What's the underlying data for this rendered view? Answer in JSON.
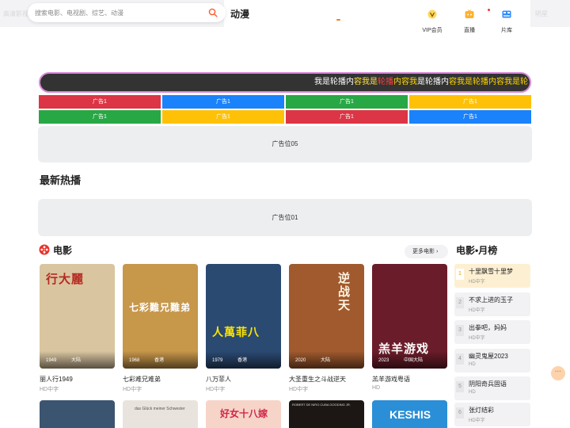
{
  "header": {
    "search_placeholder": "搜索电影、电视剧、综艺、动漫",
    "brand": "动漫",
    "faint_left": "高清影视",
    "faint_right": "明星",
    "nav": [
      {
        "label": "VIP会员",
        "icon": "vip-icon"
      },
      {
        "label": "直播",
        "icon": "live-tv-icon"
      },
      {
        "label": "片库",
        "icon": "film-library-icon"
      }
    ]
  },
  "marquee": {
    "segments": [
      {
        "text": "我是轮播内",
        "color": "#ffffff"
      },
      {
        "text": "容我是",
        "color": "#ffe040"
      },
      {
        "text": "轮播",
        "color": "#ff4040"
      },
      {
        "text": "内容我",
        "color": "#ffd700"
      },
      {
        "text": "是轮播内",
        "color": "#ffffff"
      },
      {
        "text": "容我是轮播内容我是轮",
        "color": "#ffd700"
      }
    ]
  },
  "ad_grid": [
    {
      "label": "广告1",
      "color": "#dc3545"
    },
    {
      "label": "广告1",
      "color": "#1a82fb"
    },
    {
      "label": "广告1",
      "color": "#28a745"
    },
    {
      "label": "广告1",
      "color": "#ffc107"
    },
    {
      "label": "广告1",
      "color": "#28a745"
    },
    {
      "label": "广告1",
      "color": "#ffc107"
    },
    {
      "label": "广告1",
      "color": "#dc3545"
    },
    {
      "label": "广告1",
      "color": "#1a82fb"
    }
  ],
  "ad_slot_05": "广告位05",
  "latest_title": "最新热播",
  "ad_slot_01": "广告位01",
  "movies": {
    "title": "电影",
    "more": "更多电影 ›",
    "items": [
      {
        "title": "丽人行1949",
        "quality": "HD中字",
        "year": "1949",
        "region": "大陆",
        "poster_text": "行大麗",
        "bg": "#d9c5a0",
        "fg": "#b52a22"
      },
      {
        "title": "七彩难兄难弟",
        "quality": "HD中字",
        "year": "1968",
        "region": "香港",
        "poster_text": "七彩難兄難弟",
        "bg": "#c7974a",
        "fg": "#ffffff"
      },
      {
        "title": "八万菲人",
        "quality": "HD中字",
        "year": "1979",
        "region": "香港",
        "poster_text": "人萬菲八",
        "bg": "#2b4a72",
        "fg": "#ffe600"
      },
      {
        "title": "大圣重生之斗战逆天",
        "quality": "HD中字",
        "year": "2020",
        "region": "大陆",
        "poster_text": "逆战天",
        "bg": "#a15a2e",
        "fg": "#fff3e0"
      },
      {
        "title": "羔羊游戏粤语",
        "quality": "HD",
        "year": "2023",
        "region": "中国大陆",
        "poster_text": "羔羊游戏",
        "bg": "#6b1c2a",
        "fg": "#ffffff"
      }
    ],
    "row2": [
      {
        "poster_text": "",
        "bg": "#3b5470",
        "fg": "#ffffff"
      },
      {
        "poster_text": "das Glück meiner Schwester",
        "bg": "#e8e4dd",
        "fg": "#555555"
      },
      {
        "poster_text": "好女十八嫁",
        "bg": "#f6d4c8",
        "fg": "#d0284a"
      },
      {
        "poster_text": "ROBERT DE NIRO  CUBA GOODING JR.",
        "bg": "#1c1714",
        "fg": "#dddddd"
      },
      {
        "poster_text": "KESHIS",
        "bg": "#2a8fd6",
        "fg": "#ffffff"
      }
    ]
  },
  "ranking": {
    "title": "电影•月榜",
    "items": [
      {
        "rank": "1",
        "title": "十里飘雪十里梦",
        "quality": "HD中字"
      },
      {
        "rank": "2",
        "title": "不求上进的玉子",
        "quality": "HD中字"
      },
      {
        "rank": "3",
        "title": "出拳吧，妈妈",
        "quality": "HD中字"
      },
      {
        "rank": "4",
        "title": "幽灵鬼屋2023",
        "quality": "HD"
      },
      {
        "rank": "5",
        "title": "阴阳奇兵固语",
        "quality": "HD"
      },
      {
        "rank": "6",
        "title": "张灯结彩",
        "quality": "HD中字"
      }
    ]
  },
  "float_button": "···"
}
